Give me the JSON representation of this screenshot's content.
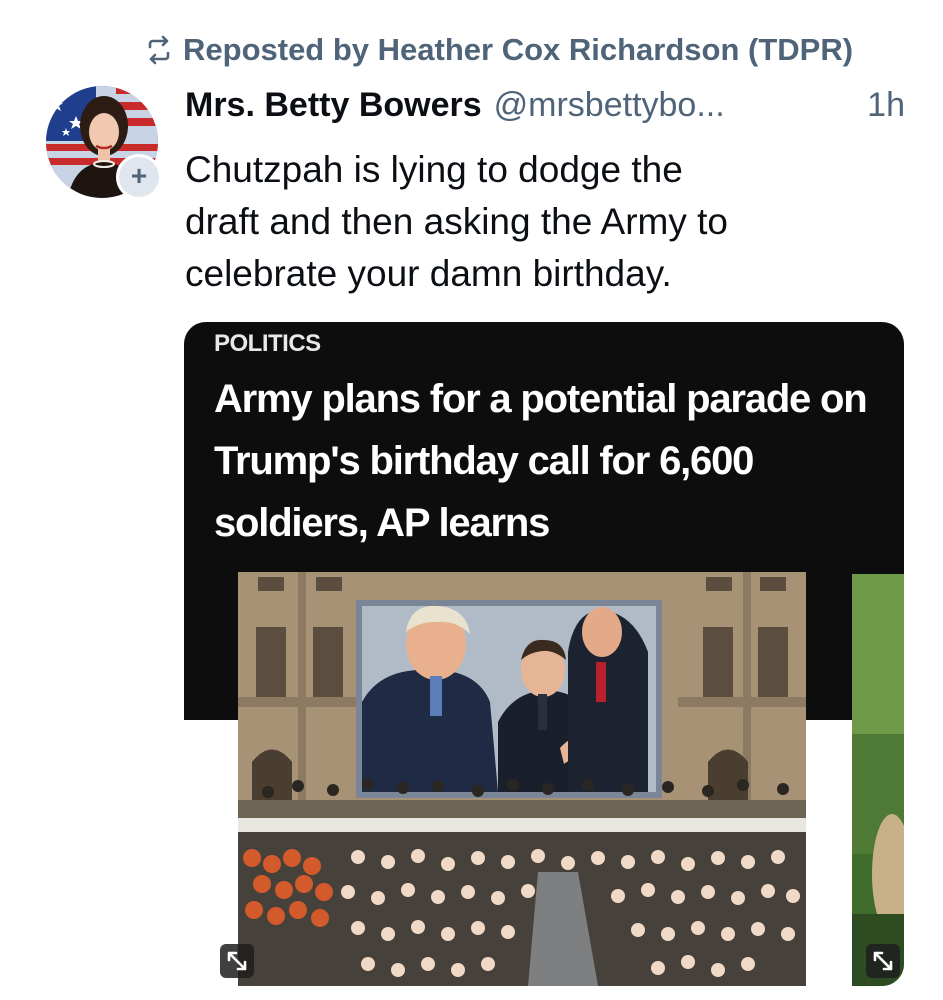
{
  "repost": {
    "icon": "repost-icon",
    "text": "Reposted by Heather Cox Richardson (TDPR)"
  },
  "author": {
    "display_name": "Mrs. Betty Bowers",
    "handle": "@mrsbettybo...",
    "time": "1h",
    "follow_badge": "+"
  },
  "post": {
    "text": "Chutzpah is lying to dodge the\ndraft and then asking the Army to\ncelebrate your damn birthday."
  },
  "media": {
    "kicker": "POLITICS",
    "headline": "Army plans for a potential parade on Trump's birthday call for 6,600 soldiers, AP learns",
    "expand_icon": "expand-icon"
  },
  "colors": {
    "muted_text": "#4f6479",
    "primary_text": "#0b0f14",
    "card_background": "#0d0d0d"
  }
}
